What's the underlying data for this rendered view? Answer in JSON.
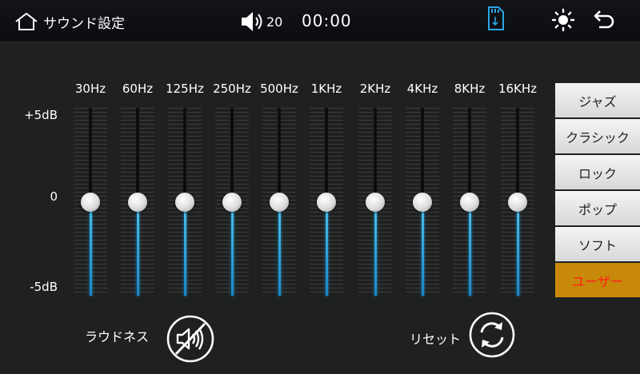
{
  "header": {
    "title": "サウンド設定",
    "volume": "20",
    "time": "00:00",
    "icons": [
      "home-icon",
      "speaker-icon",
      "sd-card-icon",
      "brightness-icon",
      "back-arrow-icon"
    ]
  },
  "equalizer": {
    "db_labels": {
      "max": "+5dB",
      "mid": "0",
      "min": "-5dB"
    },
    "bands": [
      {
        "label": "30Hz",
        "level": 0.5
      },
      {
        "label": "60Hz",
        "level": 0.5
      },
      {
        "label": "125Hz",
        "level": 0.5
      },
      {
        "label": "250Hz",
        "level": 0.5
      },
      {
        "label": "500Hz",
        "level": 0.5
      },
      {
        "label": "1KHz",
        "level": 0.5
      },
      {
        "label": "2KHz",
        "level": 0.5
      },
      {
        "label": "4KHz",
        "level": 0.5
      },
      {
        "label": "8KHz",
        "level": 0.5
      },
      {
        "label": "16KHz",
        "level": 0.5
      }
    ]
  },
  "presets": {
    "items": [
      "ジャズ",
      "クラシック",
      "ロック",
      "ポップ",
      "ソフト",
      "ユーザー"
    ],
    "selected": "ユーザー"
  },
  "loudness": {
    "label": "ラウドネス",
    "state": "off"
  },
  "reset": {
    "label": "リセット"
  },
  "colors": {
    "accent": "#2aa7e6",
    "active_preset_bg": "#c8890a",
    "active_preset_text": "#ff1a1a"
  }
}
